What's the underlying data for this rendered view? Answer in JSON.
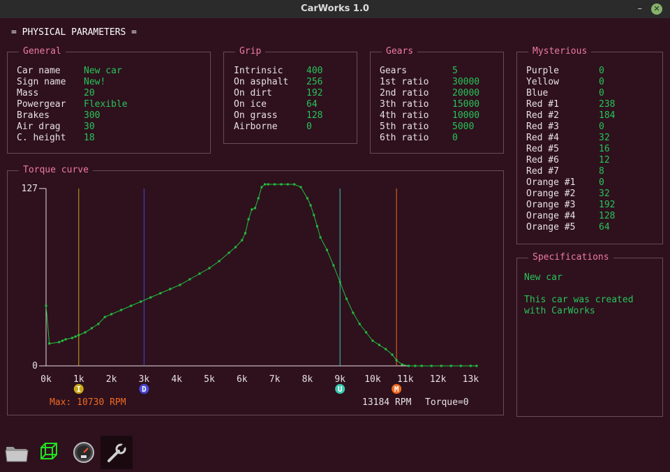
{
  "window": {
    "title": "CarWorks 1.0",
    "minimize": "–",
    "close": "✕"
  },
  "heading": "= PHYSICAL PARAMETERS =",
  "panels": {
    "general": {
      "title": "General",
      "rows": [
        {
          "k": "Car name",
          "v": "New car"
        },
        {
          "k": "Sign name",
          "v": "New!"
        },
        {
          "k": "Mass",
          "v": "20"
        },
        {
          "k": "Powergear",
          "v": "Flexible"
        },
        {
          "k": "Brakes",
          "v": "300"
        },
        {
          "k": "Air drag",
          "v": "30"
        },
        {
          "k": "C. height",
          "v": "18"
        }
      ]
    },
    "grip": {
      "title": "Grip",
      "rows": [
        {
          "k": "Intrinsic",
          "v": "400"
        },
        {
          "k": "On asphalt",
          "v": "256"
        },
        {
          "k": "On dirt",
          "v": "192"
        },
        {
          "k": "On ice",
          "v": "64"
        },
        {
          "k": "On grass",
          "v": "128"
        },
        {
          "k": "Airborne",
          "v": "0"
        }
      ]
    },
    "gears": {
      "title": "Gears",
      "rows": [
        {
          "k": "Gears",
          "v": "5"
        },
        {
          "k": "1st ratio",
          "v": "30000"
        },
        {
          "k": "2nd ratio",
          "v": "20000"
        },
        {
          "k": "3th ratio",
          "v": "15000"
        },
        {
          "k": "4th ratio",
          "v": "10000"
        },
        {
          "k": "5th ratio",
          "v": "5000"
        },
        {
          "k": "6th ratio",
          "v": "0"
        }
      ]
    },
    "mysterious": {
      "title": "Mysterious",
      "rows": [
        {
          "k": "Purple",
          "v": "0"
        },
        {
          "k": "Yellow",
          "v": "0"
        },
        {
          "k": "Blue",
          "v": "0"
        },
        {
          "k": "Red #1",
          "v": "238"
        },
        {
          "k": "Red #2",
          "v": "184"
        },
        {
          "k": "Red #3",
          "v": "0"
        },
        {
          "k": "Red #4",
          "v": "32"
        },
        {
          "k": "Red #5",
          "v": "16"
        },
        {
          "k": "Red #6",
          "v": "12"
        },
        {
          "k": "Red #7",
          "v": "8"
        },
        {
          "k": "Orange #1",
          "v": "0"
        },
        {
          "k": "Orange #2",
          "v": "32"
        },
        {
          "k": "Orange #3",
          "v": "192"
        },
        {
          "k": "Orange #4",
          "v": "128"
        },
        {
          "k": "Orange #5",
          "v": "64"
        }
      ]
    },
    "specifications": {
      "title": "Specifications",
      "name": "New car",
      "description": "This car was created\nwith CarWorks"
    }
  },
  "torque_panel": {
    "title": "Torque curve",
    "max_label": "Max: 10730 RPM",
    "rpm_readout": "13184 RPM",
    "torque_readout": "Torque=0"
  },
  "chart_data": {
    "type": "line",
    "title": "Torque curve",
    "ylim": [
      0,
      127
    ],
    "xlim": [
      0,
      13184
    ],
    "y_ticks": [
      "127",
      "0"
    ],
    "x_ticks": [
      {
        "label": "0k",
        "v": 0
      },
      {
        "label": "1k",
        "v": 1000
      },
      {
        "label": "2k",
        "v": 2000
      },
      {
        "label": "3k",
        "v": 3000
      },
      {
        "label": "4k",
        "v": 4000
      },
      {
        "label": "5k",
        "v": 5000
      },
      {
        "label": "6k",
        "v": 6000
      },
      {
        "label": "7k",
        "v": 7000
      },
      {
        "label": "8k",
        "v": 8000
      },
      {
        "label": "9k",
        "v": 9000
      },
      {
        "label": "10k",
        "v": 10000
      },
      {
        "label": "11k",
        "v": 11000
      },
      {
        "label": "12k",
        "v": 12000
      },
      {
        "label": "13k",
        "v": 13000
      }
    ],
    "markers": [
      {
        "letter": "I",
        "rpm": 1000,
        "color": "#c8a818"
      },
      {
        "letter": "D",
        "rpm": 3000,
        "color": "#4848d8"
      },
      {
        "letter": "U",
        "rpm": 9000,
        "color": "#3ac8b0"
      },
      {
        "letter": "M",
        "rpm": 10730,
        "color": "#f06a22"
      }
    ],
    "series": [
      {
        "color": "#22c040",
        "x": [
          0,
          100,
          400,
          500,
          600,
          800,
          900,
          1000,
          1200,
          1400,
          1600,
          1800,
          2000,
          2300,
          2600,
          2900,
          3200,
          3500,
          3800,
          4100,
          4400,
          4700,
          5000,
          5300,
          5600,
          5800,
          6000,
          6100,
          6200,
          6300,
          6400,
          6500,
          6600,
          6700,
          6800,
          7000,
          7200,
          7400,
          7600,
          7800,
          8000,
          8100,
          8200,
          8300,
          8400,
          8600,
          8800,
          9000,
          9200,
          9400,
          9600,
          9800,
          10000,
          10200,
          10400,
          10600,
          10730,
          10900,
          11100,
          11300,
          11500,
          11800,
          12100,
          12400,
          12700,
          13000,
          13184
        ],
        "y": [
          43,
          16,
          17,
          18,
          19,
          20,
          21,
          22,
          24,
          27,
          30,
          35,
          37,
          40,
          43,
          46,
          49,
          52,
          55,
          58,
          62,
          66,
          70,
          75,
          81,
          85,
          90,
          95,
          105,
          112,
          113,
          120,
          128,
          130,
          130,
          130,
          130,
          130,
          130,
          128,
          120,
          115,
          108,
          100,
          92,
          83,
          72,
          60,
          48,
          38,
          30,
          24,
          18,
          15,
          12,
          8,
          4,
          1,
          0,
          0,
          0,
          0,
          0,
          0,
          0,
          0,
          0
        ]
      }
    ]
  },
  "toolbar": {
    "icons": [
      "folder-icon",
      "cube-icon",
      "gauge-icon",
      "wrench-icon"
    ]
  },
  "colors": {
    "background": "#2e111d",
    "title": "#f07aa0",
    "value": "#27c35a",
    "accent": "#f06a22"
  }
}
